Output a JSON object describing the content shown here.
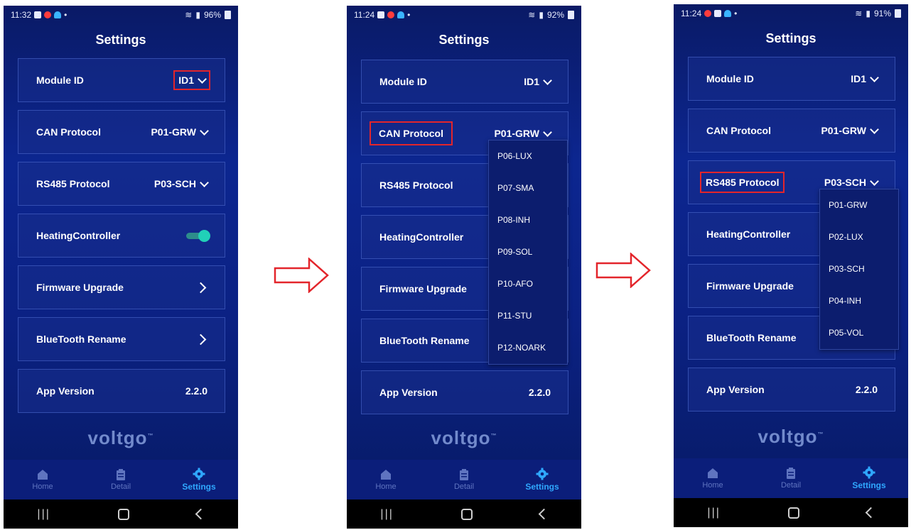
{
  "panels": [
    {
      "time": "11:32",
      "battery": "96%",
      "title": "Settings",
      "rows": {
        "module_id": {
          "label": "Module ID",
          "value": "ID1"
        },
        "can": {
          "label": "CAN Protocol",
          "value": "P01-GRW"
        },
        "rs485": {
          "label": "RS485 Protocol",
          "value": "P03-SCH"
        },
        "heating": {
          "label": "HeatingController"
        },
        "firmware": {
          "label": "Firmware Upgrade"
        },
        "bt": {
          "label": "BlueTooth Rename"
        },
        "version": {
          "label": "App Version",
          "value": "2.2.0"
        }
      },
      "brand": "voltgo",
      "tabs": [
        "Home",
        "Detail",
        "Settings"
      ],
      "heating_on": true
    },
    {
      "time": "11:24",
      "battery": "92%",
      "title": "Settings",
      "rows": {
        "module_id": {
          "label": "Module ID",
          "value": "ID1"
        },
        "can": {
          "label": "CAN Protocol",
          "value": "P01-GRW"
        },
        "rs485": {
          "label": "RS485 Protocol"
        },
        "heating": {
          "label": "HeatingController"
        },
        "firmware": {
          "label": "Firmware Upgrade"
        },
        "bt": {
          "label": "BlueTooth Rename"
        },
        "version": {
          "label": "App Version",
          "value": "2.2.0"
        }
      },
      "dropdown": [
        "P06-LUX",
        "P07-SMA",
        "P08-INH",
        "P09-SOL",
        "P10-AFO",
        "P11-STU",
        "P12-NOARK"
      ],
      "brand": "voltgo",
      "tabs": [
        "Home",
        "Detail",
        "Settings"
      ]
    },
    {
      "time": "11:24",
      "battery": "91%",
      "title": "Settings",
      "rows": {
        "module_id": {
          "label": "Module ID",
          "value": "ID1"
        },
        "can": {
          "label": "CAN Protocol",
          "value": "P01-GRW"
        },
        "rs485": {
          "label": "RS485 Protocol",
          "value": "P03-SCH"
        },
        "heating": {
          "label": "HeatingController"
        },
        "firmware": {
          "label": "Firmware Upgrade"
        },
        "bt": {
          "label": "BlueTooth Rename"
        },
        "version": {
          "label": "App Version",
          "value": "2.2.0"
        }
      },
      "dropdown": [
        "P01-GRW",
        "P02-LUX",
        "P03-SCH",
        "P04-INH",
        "P05-VOL"
      ],
      "brand": "voltgo",
      "tabs": [
        "Home",
        "Detail",
        "Settings"
      ]
    }
  ],
  "colors": {
    "highlight": "#e3252b",
    "accent": "#2fa8ff",
    "toggle": "#21d0b8"
  },
  "icons": {
    "next_step": "right-arrow-icon",
    "home": "home-icon",
    "detail": "clipboard-icon",
    "settings": "gear-icon"
  }
}
